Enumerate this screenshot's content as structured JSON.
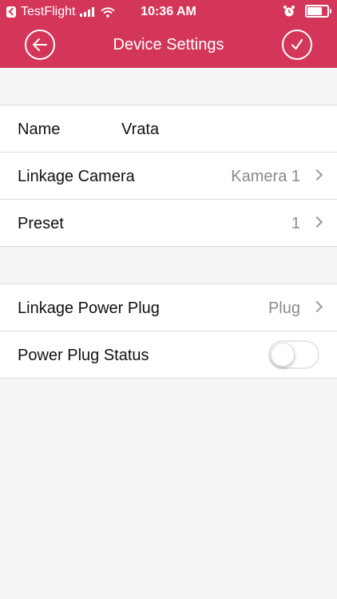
{
  "status_bar": {
    "carrier": "TestFlight",
    "time": "10:36 AM",
    "battery_level": 0.9
  },
  "nav": {
    "title": "Device Settings"
  },
  "section1": {
    "name_label": "Name",
    "name_value": "Vrata",
    "camera_label": "Linkage Camera",
    "camera_value": "Kamera 1",
    "preset_label": "Preset",
    "preset_value": "1"
  },
  "section2": {
    "plug_label": "Linkage Power Plug",
    "plug_value": "Plug",
    "status_label": "Power Plug Status",
    "status_on": false
  },
  "colors": {
    "accent": "#d4365a",
    "background": "#f5f5f5"
  }
}
